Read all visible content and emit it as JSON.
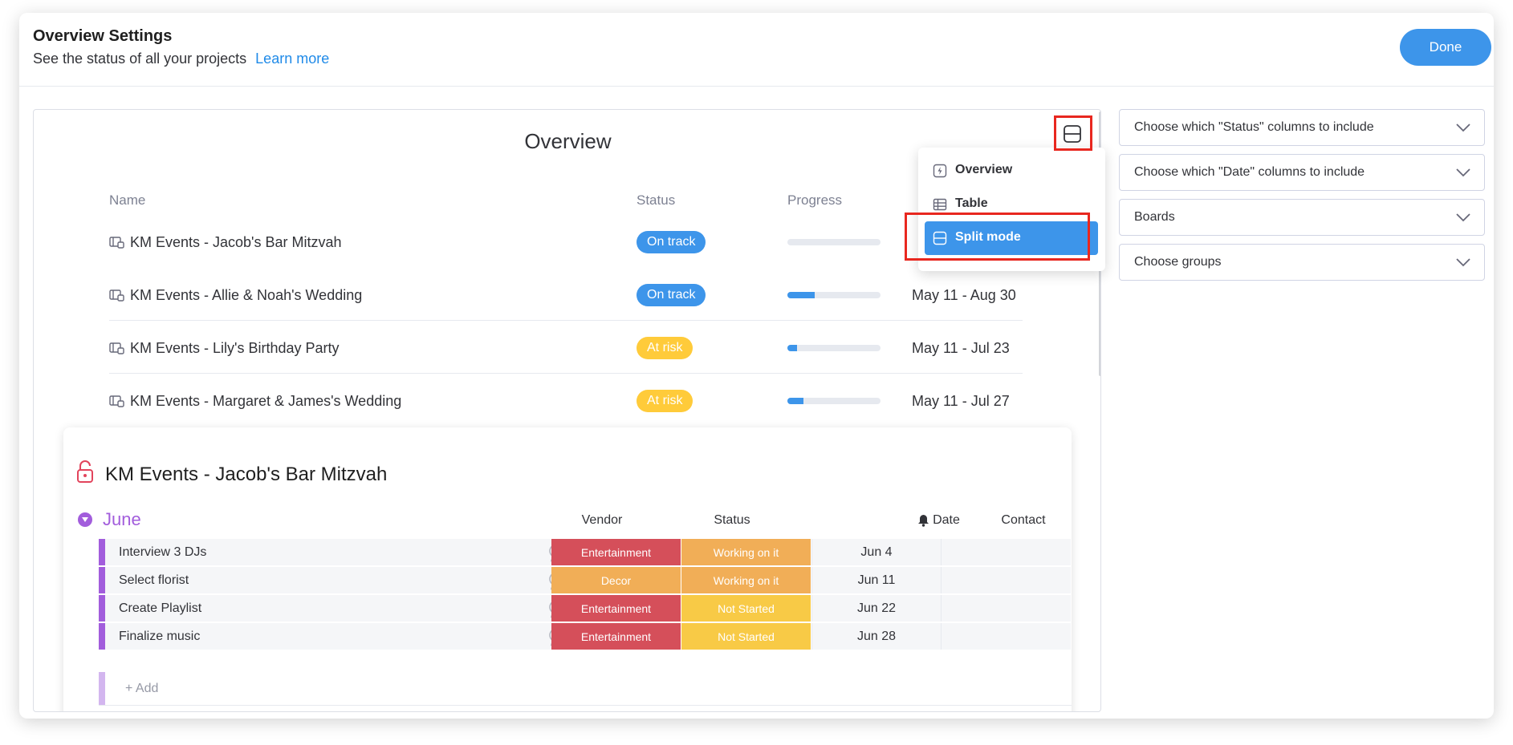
{
  "header": {
    "title": "Overview Settings",
    "subtitle": "See the status of all your projects",
    "learn_more": "Learn more",
    "done_label": "Done"
  },
  "overview": {
    "title": "Overview",
    "columns": {
      "name": "Name",
      "status": "Status",
      "progress": "Progress"
    },
    "projects": [
      {
        "name": "KM Events - Jacob's Bar Mitzvah",
        "status": "On track",
        "status_color": "#3d95ea",
        "progress": 0.0,
        "date": ""
      },
      {
        "name": "KM Events - Allie & Noah's Wedding",
        "status": "On track",
        "status_color": "#3d95ea",
        "progress": 0.29,
        "date": "May 11 - Aug 30"
      },
      {
        "name": "KM Events - Lily's Birthday Party",
        "status": "At risk",
        "status_color": "#ffcb3a",
        "progress": 0.1,
        "date": "May 11 - Jul 23"
      },
      {
        "name": "KM Events - Margaret & James's Wedding",
        "status": "At risk",
        "status_color": "#ffcb3a",
        "progress": 0.17,
        "date": "May 11 - Jul 27"
      }
    ]
  },
  "view_menu": {
    "items": [
      {
        "label": "Overview",
        "icon": "overview-icon",
        "selected": false
      },
      {
        "label": "Table",
        "icon": "table-icon",
        "selected": false
      },
      {
        "label": "Split mode",
        "icon": "split-mode-icon",
        "selected": true
      }
    ]
  },
  "board": {
    "title": "KM Events - Jacob's Bar Mitzvah",
    "group": "June",
    "group_color": "#a25ddc",
    "columns": {
      "vendor": "Vendor",
      "status": "Status",
      "date": "Date",
      "contact": "Contact"
    },
    "rows": [
      {
        "name": "Interview 3 DJs",
        "vendor": "Entertainment",
        "vendor_color": "#d54f5a",
        "status": "Working on it",
        "status_color": "#f1ae57",
        "date": "Jun 4"
      },
      {
        "name": "Select florist",
        "vendor": "Decor",
        "vendor_color": "#f1ae57",
        "status": "Working on it",
        "status_color": "#f1ae57",
        "date": "Jun 11"
      },
      {
        "name": "Create Playlist",
        "vendor": "Entertainment",
        "vendor_color": "#d54f5a",
        "status": "Not Started",
        "status_color": "#f8ca46",
        "date": "Jun 22"
      },
      {
        "name": "Finalize music",
        "vendor": "Entertainment",
        "vendor_color": "#d54f5a",
        "status": "Not Started",
        "status_color": "#f8ca46",
        "date": "Jun 28"
      }
    ],
    "add_label": "+ Add"
  },
  "settings": [
    "Choose which \"Status\" columns to include",
    "Choose which \"Date\" columns to include",
    "Boards",
    "Choose groups"
  ]
}
